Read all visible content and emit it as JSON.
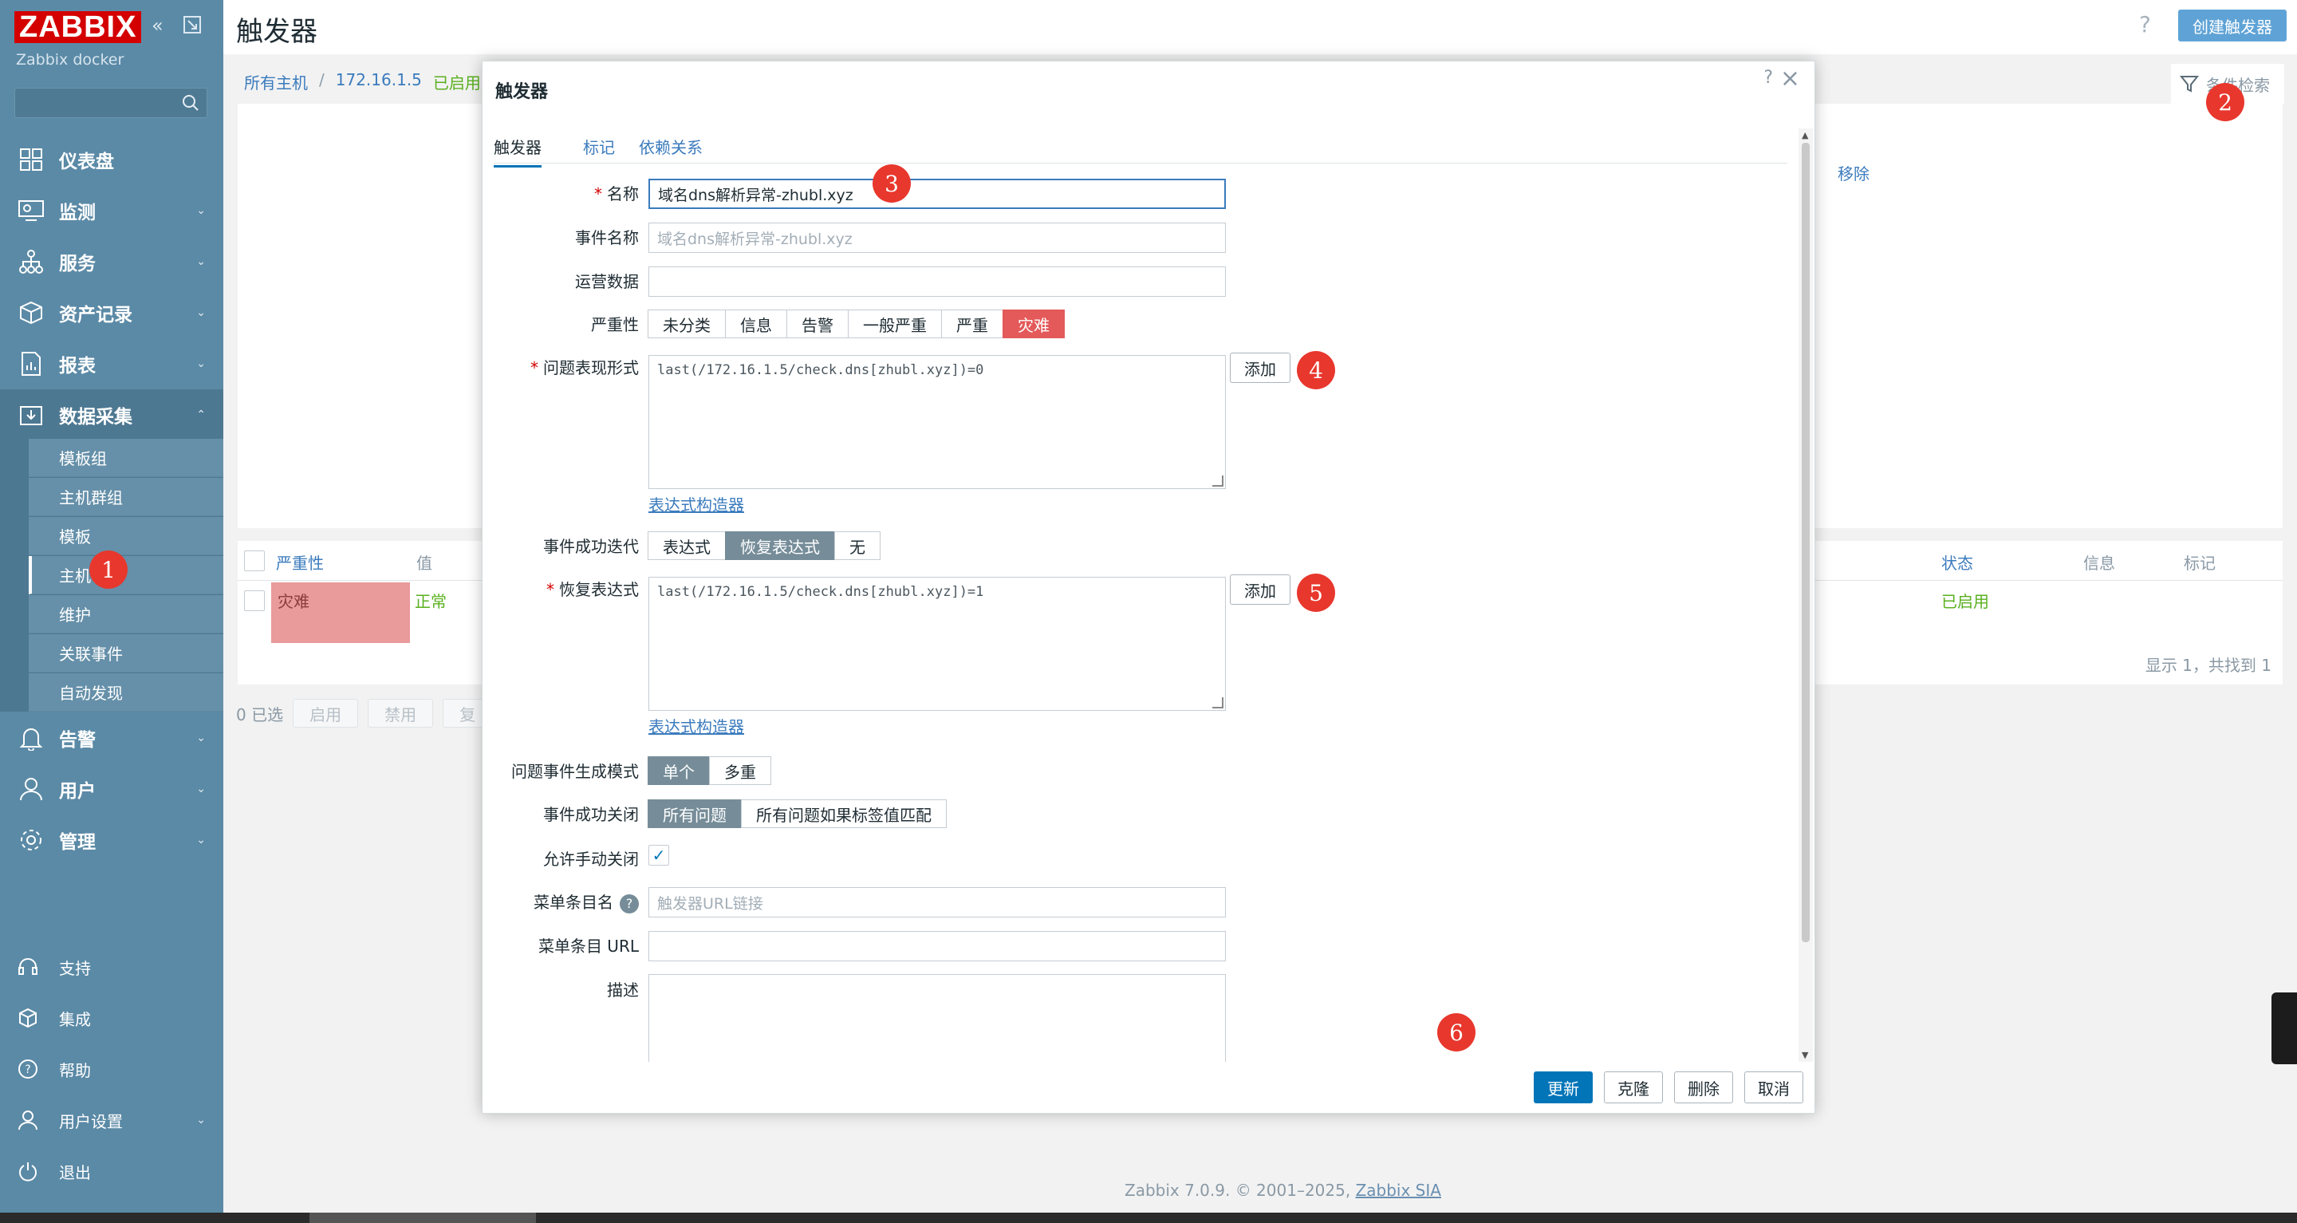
{
  "sidebar": {
    "logo": "ZABBIX",
    "subtitle": "Zabbix docker",
    "menu": [
      {
        "label": "仪表盘"
      },
      {
        "label": "监测"
      },
      {
        "label": "服务"
      },
      {
        "label": "资产记录"
      },
      {
        "label": "报表"
      },
      {
        "label": "数据采集"
      },
      {
        "label": "告警"
      },
      {
        "label": "用户"
      },
      {
        "label": "管理"
      }
    ],
    "submenu": [
      "模板组",
      "主机群组",
      "模板",
      "主机",
      "维护",
      "关联事件",
      "自动发现"
    ],
    "bottom": [
      {
        "label": "支持"
      },
      {
        "label": "集成"
      },
      {
        "label": "帮助"
      },
      {
        "label": "用户设置"
      },
      {
        "label": "退出"
      }
    ]
  },
  "header": {
    "title": "触发器",
    "help": "?",
    "create_button": "创建触发器"
  },
  "breadcrumb": {
    "all_hosts": "所有主机",
    "sep": "/",
    "host": "172.16.1.5",
    "enabled": "已启用"
  },
  "filter": {
    "label": "条件检索",
    "remove": "移除"
  },
  "list": {
    "headers": {
      "severity": "严重性",
      "value": "值",
      "status": "状态",
      "info": "信息",
      "tags": "标记"
    },
    "row": {
      "severity": "灾难",
      "value": "正常",
      "status": "已启用"
    },
    "footer": "显示 1，共找到 1"
  },
  "bulk": {
    "selected": "0 已选",
    "enable": "启用",
    "disable": "禁用",
    "copy": "复"
  },
  "footer": {
    "text": "Zabbix 7.0.9. © 2001–2025,",
    "link": "Zabbix SIA"
  },
  "modal": {
    "title": "触发器",
    "help": "?",
    "close": "×",
    "tabs": [
      "触发器",
      "标记",
      "依赖关系"
    ],
    "labels": {
      "name": "名称",
      "event_name": "事件名称",
      "opdata": "运营数据",
      "severity": "严重性",
      "problem_expr": "问题表现形式",
      "ok_event_gen": "事件成功迭代",
      "recovery_expr": "恢复表达式",
      "problem_mode": "问题事件生成模式",
      "ok_close": "事件成功关闭",
      "manual_close": "允许手动关闭",
      "menu_name": "菜单条目名",
      "menu_url": "菜单条目 URL",
      "description": "描述"
    },
    "values": {
      "name": "域名dns解析异常-zhubl.xyz",
      "event_name_placeholder": "域名dns解析异常-zhubl.xyz",
      "opdata": "",
      "problem_expr": "last(/172.16.1.5/check.dns[zhubl.xyz])=0",
      "recovery_expr": "last(/172.16.1.5/check.dns[zhubl.xyz])=1",
      "menu_name_placeholder": "触发器URL链接",
      "menu_url": "",
      "description": "",
      "manual_close_check": "✓"
    },
    "severity_options": [
      "未分类",
      "信息",
      "告警",
      "一般严重",
      "严重",
      "灾难"
    ],
    "ok_event_options": [
      "表达式",
      "恢复表达式",
      "无"
    ],
    "problem_mode_options": [
      "单个",
      "多重"
    ],
    "ok_close_options": [
      "所有问题",
      "所有问题如果标签值匹配"
    ],
    "add_button": "添加",
    "expr_builder": "表达式构造器",
    "help_icon": "?",
    "buttons": {
      "update": "更新",
      "clone": "克隆",
      "delete": "删除",
      "cancel": "取消"
    }
  },
  "badges": [
    "1",
    "2",
    "3",
    "4",
    "5",
    "6"
  ]
}
